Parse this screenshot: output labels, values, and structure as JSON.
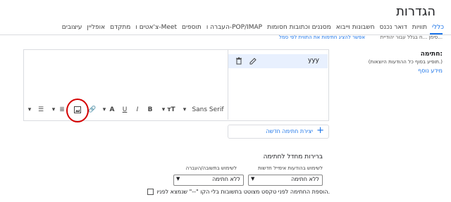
{
  "header": {
    "title": "הגדרות"
  },
  "tabs": [
    {
      "label": "כללי",
      "active": true
    },
    {
      "label": "תוויות"
    },
    {
      "label": "דואר נכנס"
    },
    {
      "label": "חשבונות וייבוא"
    },
    {
      "label": "מסננים וכתובות חסומות"
    },
    {
      "label": "העברה ו-POP/IMAP"
    },
    {
      "label": "תוספים"
    },
    {
      "label": "צ'אטים ו-Meet"
    },
    {
      "label": "מתקדם"
    },
    {
      "label": "אופליין"
    },
    {
      "label": "עיצובים"
    }
  ],
  "partial_row": {
    "right_text": "סימן ...ח בגלל עבור יהודיית...",
    "center_text": "אפשר להציג חתימות את התווית לפי סמל"
  },
  "signature": {
    "label": "חתימה:",
    "description": "(תופיע בסוף כל ההודעות היוצאות.)",
    "learn_more": "מידע נוסף",
    "items": [
      {
        "name": "yyy",
        "selected": true
      }
    ],
    "create_new": "יצירת חתימה חדשה"
  },
  "toolbar": {
    "font": "Sans Serif",
    "items": [
      "more-options",
      "list",
      "indent",
      "image",
      "link",
      "text-color",
      "underline",
      "italic",
      "bold",
      "text-size",
      "font"
    ]
  },
  "defaults": {
    "title": "ברירות מחדל לחתימה",
    "new_emails_label": "לשימוש בהודעות אימייל חדשות",
    "new_emails_value": "ללא חתימה",
    "reply_label": "לשימוש בתשובה/העברה",
    "reply_value": "ללא חתימה",
    "insert_before_quote": "הוספת החתימה לפני טקסט מצוטט בתשובות בלי הקו \"--\" שנמצא לפניו."
  },
  "colors": {
    "accent": "#1a73e8",
    "highlight": "#d50000",
    "selected_row": "#e8f0fe"
  }
}
